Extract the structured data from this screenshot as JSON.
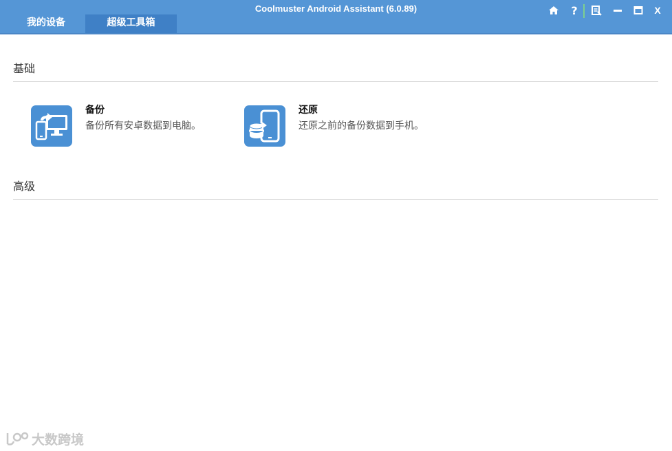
{
  "window": {
    "title": "Coolmuster Android Assistant (6.0.89)",
    "colors": {
      "titlebar": "#5596d6",
      "active_tab": "#3f80c6",
      "icon_bg": "#4a90d4"
    }
  },
  "tabs": [
    {
      "label": "我的设备",
      "active": false
    },
    {
      "label": "超级工具箱",
      "active": true
    }
  ],
  "controls": {
    "home": "home-icon",
    "help": "help-icon",
    "feedback": "feedback-icon",
    "minimize": "minimize-icon",
    "maximize": "maximize-icon",
    "close_label": "X"
  },
  "sections": {
    "basic": {
      "title": "基础",
      "items": [
        {
          "title": "备份",
          "desc": "备份所有安卓数据到电脑。",
          "icon": "backup-icon"
        },
        {
          "title": "还原",
          "desc": "还原之前的备份数据到手机。",
          "icon": "restore-icon"
        }
      ]
    },
    "advanced": {
      "title": "高级"
    }
  },
  "watermark": {
    "text": "大数跨境"
  }
}
